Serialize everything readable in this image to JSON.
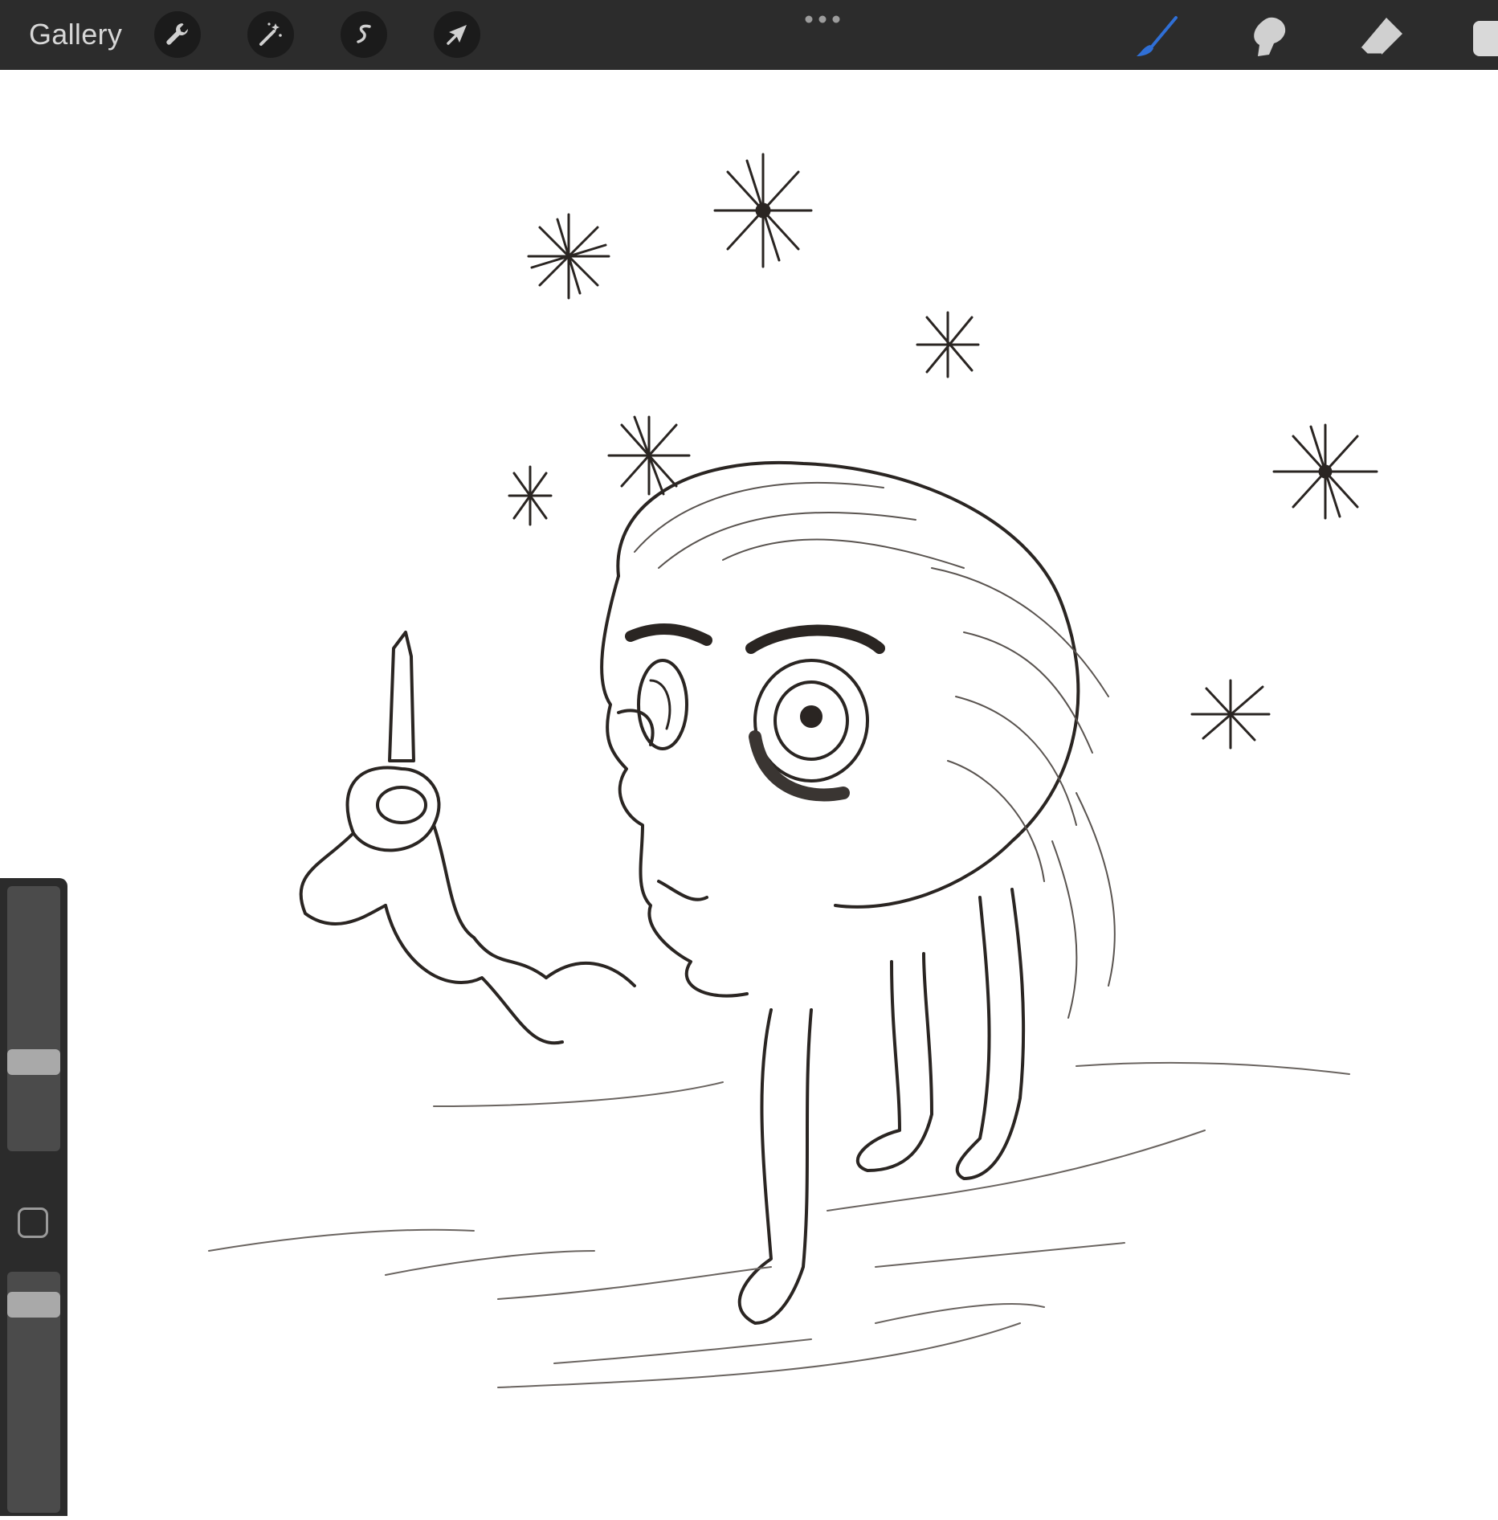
{
  "toolbar": {
    "gallery_label": "Gallery",
    "left_tools": [
      {
        "icon": "wrench-icon",
        "name": "actions"
      },
      {
        "icon": "magic-wand-icon",
        "name": "adjustments"
      },
      {
        "icon": "selection-s-icon",
        "name": "selection"
      },
      {
        "icon": "arrow-cursor-icon",
        "name": "transform"
      }
    ],
    "more_icon": "ellipsis-icon",
    "right_tools": [
      {
        "icon": "brush-icon",
        "name": "paint",
        "active": true
      },
      {
        "icon": "smudge-icon",
        "name": "smudge",
        "active": false
      },
      {
        "icon": "eraser-icon",
        "name": "eraser",
        "active": false
      },
      {
        "icon": "layers-icon",
        "name": "layers",
        "active": false
      }
    ]
  },
  "sidebar": {
    "brush_size_level": 0.35,
    "opacity_level": 0.95
  },
  "colors": {
    "toolbar_bg": "#2c2c2c",
    "active_tool": "#2f6fd6",
    "inactive_tool": "#d0d0d0",
    "ink": "#2a2522"
  }
}
